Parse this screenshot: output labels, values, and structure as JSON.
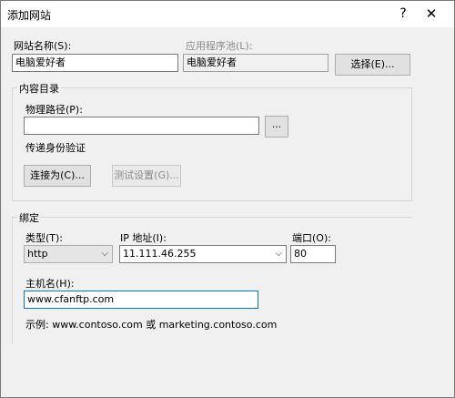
{
  "window": {
    "title": "添加网站",
    "help": "?",
    "close": "✕"
  },
  "site_name": {
    "label": "网站名称(S):",
    "value": "电脑爱好者"
  },
  "app_pool": {
    "label": "应用程序池(L):",
    "value": "电脑爱好者",
    "select_button": "选择(E)..."
  },
  "content_dir": {
    "group_title": "内容目录",
    "path_label": "物理路径(P):",
    "path_value": "",
    "browse_button": "...",
    "pass_auth_label": "传递身份验证",
    "connect_as_button": "连接为(C)...",
    "test_settings_button": "测试设置(G)..."
  },
  "binding": {
    "group_title": "绑定",
    "type_label": "类型(T):",
    "type_value": "http",
    "ip_label": "IP 地址(I):",
    "ip_value": "11.111.46.255",
    "port_label": "端口(O):",
    "port_value": "80",
    "host_label": "主机名(H):",
    "host_value": "www.cfanftp.com",
    "example_text": "示例: www.contoso.com 或 marketing.contoso.com"
  }
}
